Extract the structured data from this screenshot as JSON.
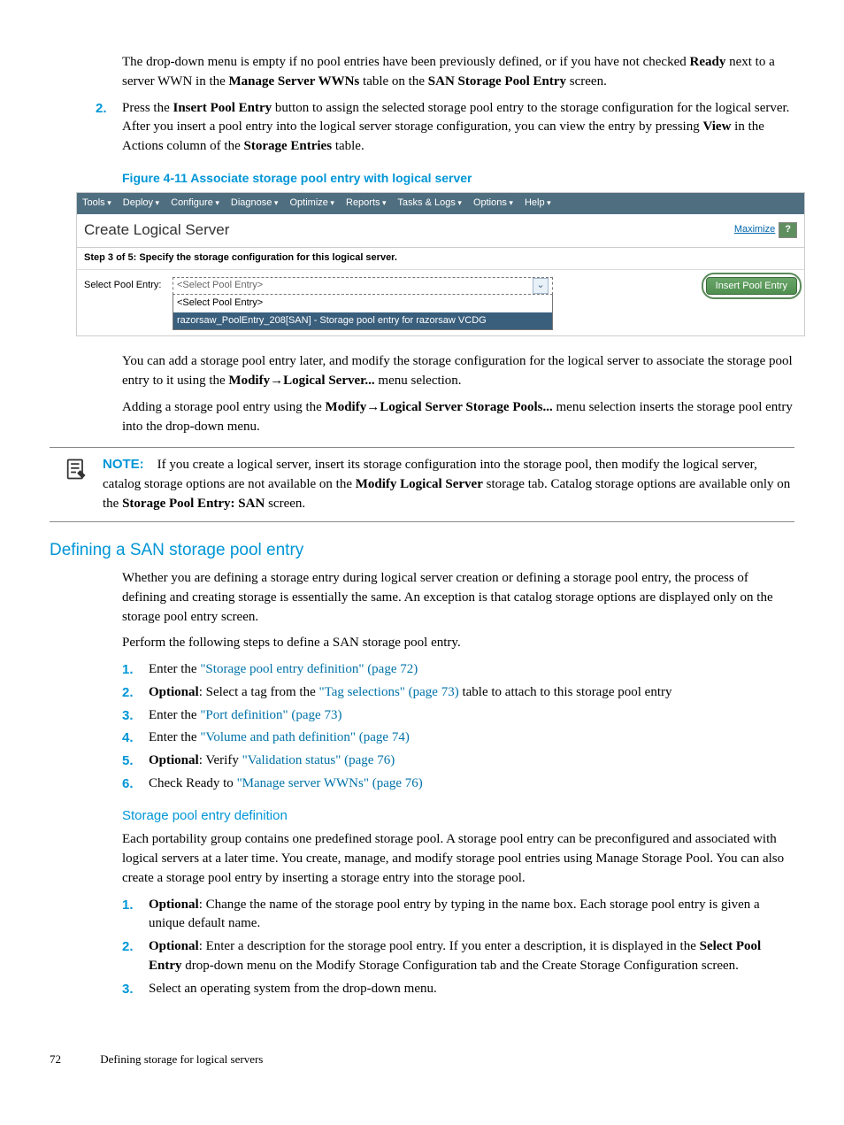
{
  "intro": {
    "p1a": "The drop-down menu is empty if no pool entries have been previously defined, or if you have not checked ",
    "bold_ready": "Ready",
    "p1b": " next to a server WWN in the ",
    "bold_mgt": "Manage Server WWNs",
    "p1c": " table on the ",
    "bold_san": "SAN Storage Pool Entry",
    "p1d": " screen."
  },
  "step2": {
    "num": "2.",
    "a": "Press the ",
    "b_insert": "Insert Pool Entry",
    "b": " button to assign the selected storage pool entry to the storage configuration for the logical server. After you insert a pool entry into the logical server storage configuration, you can view the entry by pressing ",
    "b_view": "View",
    "c": " in the Actions column of the ",
    "b_storage": "Storage Entries",
    "d": " table."
  },
  "figure": {
    "caption": "Figure 4-11 Associate storage pool entry with logical server",
    "menu": {
      "tools": "Tools",
      "deploy": "Deploy",
      "configure": "Configure",
      "diagnose": "Diagnose",
      "optimize": "Optimize",
      "reports": "Reports",
      "tasks": "Tasks & Logs",
      "options": "Options",
      "help": "Help"
    },
    "title": "Create Logical Server",
    "maximize": "Maximize",
    "help_icon": "?",
    "step": "Step 3 of 5: Specify the storage configuration for this logical server.",
    "select_label": "Select Pool Entry:",
    "placeholder": "<Select Pool Entry>",
    "opt1": "<Select Pool Entry>",
    "opt2": "razorsaw_PoolEntry_208[SAN] - Storage pool entry for razorsaw VCDG",
    "insert_btn": "Insert Pool Entry"
  },
  "after_fig": {
    "p1a": "You can add a storage pool entry later, and modify the storage configuration for the logical server to associate the storage pool entry to it using the ",
    "b_modify": "Modify",
    "arrow": "→",
    "b_logical": "Logical Server...",
    "p1c": " menu selection.",
    "p2a": "Adding a storage pool entry using the ",
    "b_logical2": "Logical Server Storage Pools...",
    "p2c": " menu selection inserts the storage pool entry into the drop-down menu."
  },
  "note": {
    "label": "NOTE:",
    "a": "If you create a logical server, insert its storage configuration into the storage pool, then modify the logical server, catalog storage options are not available on the ",
    "b_mls": "Modify Logical Server",
    "b": " storage tab. Catalog storage options are available only on the ",
    "b_spe": "Storage Pool Entry: SAN",
    "c": " screen."
  },
  "section2": {
    "heading": "Defining a SAN storage pool entry",
    "p1": "Whether you are defining a storage entry during logical server creation or defining a storage pool entry, the process of defining and creating storage is essentially the same. An exception is that catalog storage options are displayed only on the storage pool entry screen.",
    "p2": "Perform the following steps to define a SAN storage pool entry.",
    "items": {
      "n1": "1.",
      "t1a": "Enter the ",
      "t1l": "\"Storage pool entry definition\" (page 72)",
      "n2": "2.",
      "t2a": "Optional",
      "t2b": ": Select a tag from the ",
      "t2l": "\"Tag selections\" (page 73)",
      "t2c": " table to attach to this storage pool entry",
      "n3": "3.",
      "t3a": "Enter the ",
      "t3l": "\"Port definition\" (page 73)",
      "n4": "4.",
      "t4a": "Enter the ",
      "t4l": "\"Volume and path definition\" (page 74)",
      "n5": "5.",
      "t5a": "Optional",
      "t5b": ": Verify ",
      "t5l": "\"Validation status\" (page 76)",
      "n6": "6.",
      "t6a": "Check Ready to ",
      "t6l": "\"Manage server WWNs\" (page 76)"
    }
  },
  "section3": {
    "heading": "Storage pool entry definition",
    "p1": "Each portability group contains one predefined storage pool. A storage pool entry can be preconfigured and associated with logical servers at a later time. You create, manage, and modify storage pool entries using Manage Storage Pool. You can also create a storage pool entry by inserting a storage entry into the storage pool.",
    "items": {
      "n1": "1.",
      "t1a": "Optional",
      "t1b": ": Change the name of the storage pool entry by typing in the name box. Each storage pool entry is given a unique default name.",
      "n2": "2.",
      "t2a": "Optional",
      "t2b": ": Enter a description for the storage pool entry. If you enter a description, it is displayed in the ",
      "t2bold": "Select Pool Entry",
      "t2c": " drop-down menu on the Modify Storage Configuration tab and the Create Storage Configuration screen.",
      "n3": "3.",
      "t3": "Select an operating system from the drop-down menu."
    }
  },
  "footer": {
    "page": "72",
    "title": "Defining storage for logical servers"
  }
}
